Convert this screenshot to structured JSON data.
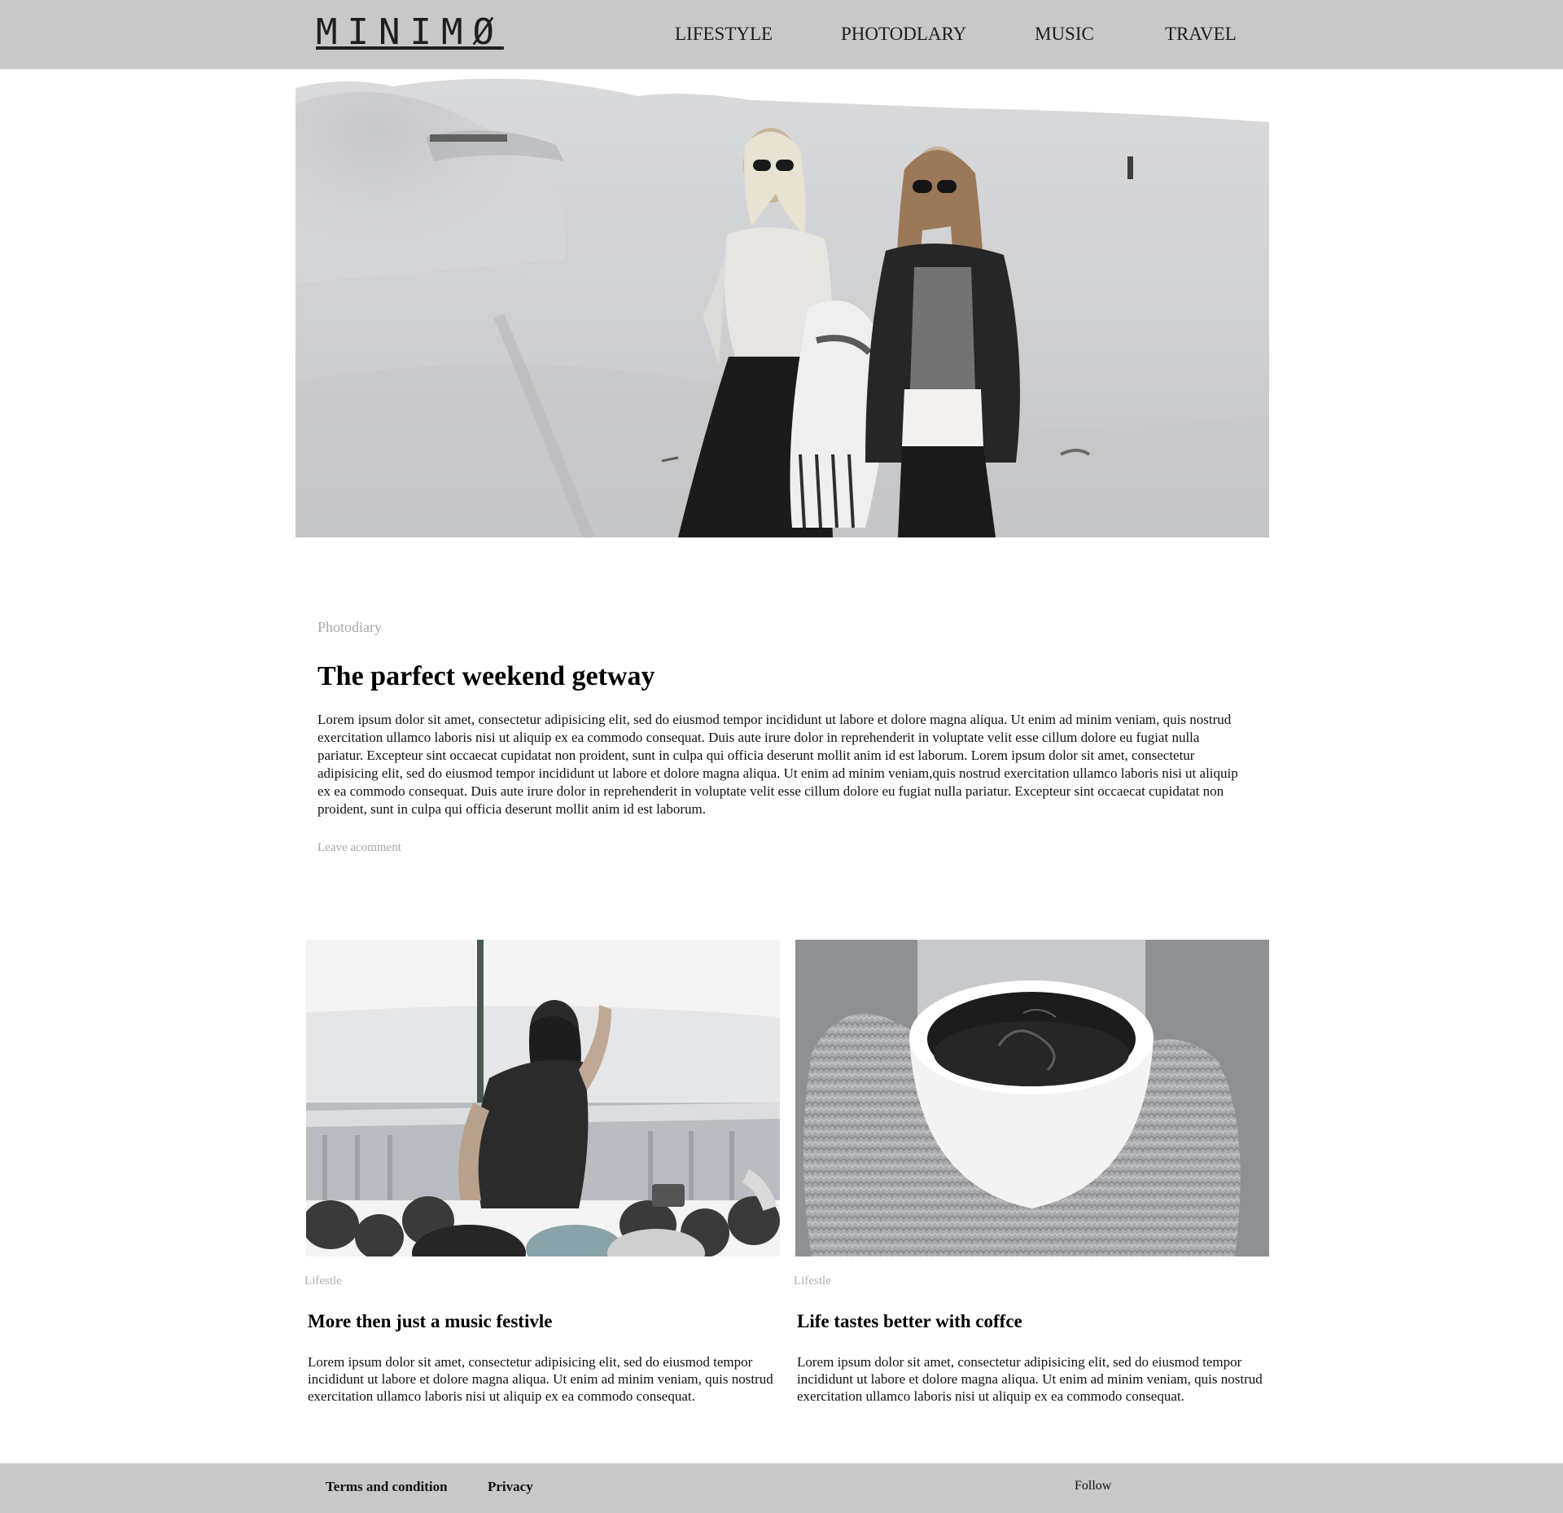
{
  "header": {
    "logo": "MINIMØ",
    "nav": [
      "LIFESTYLE",
      "PHOTODLARY",
      "MUSIC",
      "TRAVEL"
    ]
  },
  "hero": {
    "image": "two-women-walking-on-sand-dunes-photo"
  },
  "feature": {
    "category": "Photodiary",
    "title": "The parfect weekend getway",
    "body": "Lorem ipsum dolor sit amet, consectetur adipisicing elit, sed do eiusmod tempor incididunt ut labore et dolore magna aliqua. Ut enim ad minim veniam, quis nostrud exercitation ullamco laboris nisi ut aliquip ex ea commodo consequat. Duis aute irure dolor in reprehenderit in voluptate velit esse cillum dolore eu fugiat nulla pariatur. Excepteur sint occaecat cupidatat non proident, sunt in culpa qui officia deserunt mollit anim id est laborum. Lorem ipsum dolor sit amet, consectetur adipisicing elit, sed do eiusmod tempor incididunt ut labore et dolore magna aliqua. Ut enim ad minim veniam,quis nostrud exercitation ullamco laboris nisi ut aliquip ex ea commodo consequat. Duis aute irure dolor in reprehenderit in voluptate velit esse cillum dolore eu fugiat nulla pariatur. Excepteur sint occaecat cupidatat non proident, sunt in culpa qui officia deserunt mollit anim id est laborum.",
    "comment_link": "Leave acomment"
  },
  "cards": [
    {
      "image": "woman-at-music-festival-crowd-photo",
      "category": "Lifestle",
      "title": "More then just a music festivle",
      "body": "Lorem ipsum dolor sit amet, consectetur adipisicing elit, sed do eiusmod tempor incididunt ut labore et dolore magna aliqua. Ut enim ad minim veniam, quis nostrud exercitation ullamco laboris nisi ut aliquip ex ea commodo consequat."
    },
    {
      "image": "hands-in-knit-mittens-holding-coffee-cup-photo",
      "category": "Lifestle",
      "title": "Life tastes better with coffce",
      "body": "Lorem ipsum dolor sit amet, consectetur adipisicing elit, sed do eiusmod tempor incididunt ut labore et dolore magna aliqua. Ut enim ad minim veniam, quis nostrud exercitation ullamco laboris nisi ut aliquip ex ea commodo consequat."
    }
  ],
  "footer": {
    "terms": "Terms and condition",
    "privacy": "Privacy",
    "follow": "Follow"
  },
  "colors": {
    "bar_background": "#c9c8c9",
    "muted_text": "#a8a8a8"
  }
}
